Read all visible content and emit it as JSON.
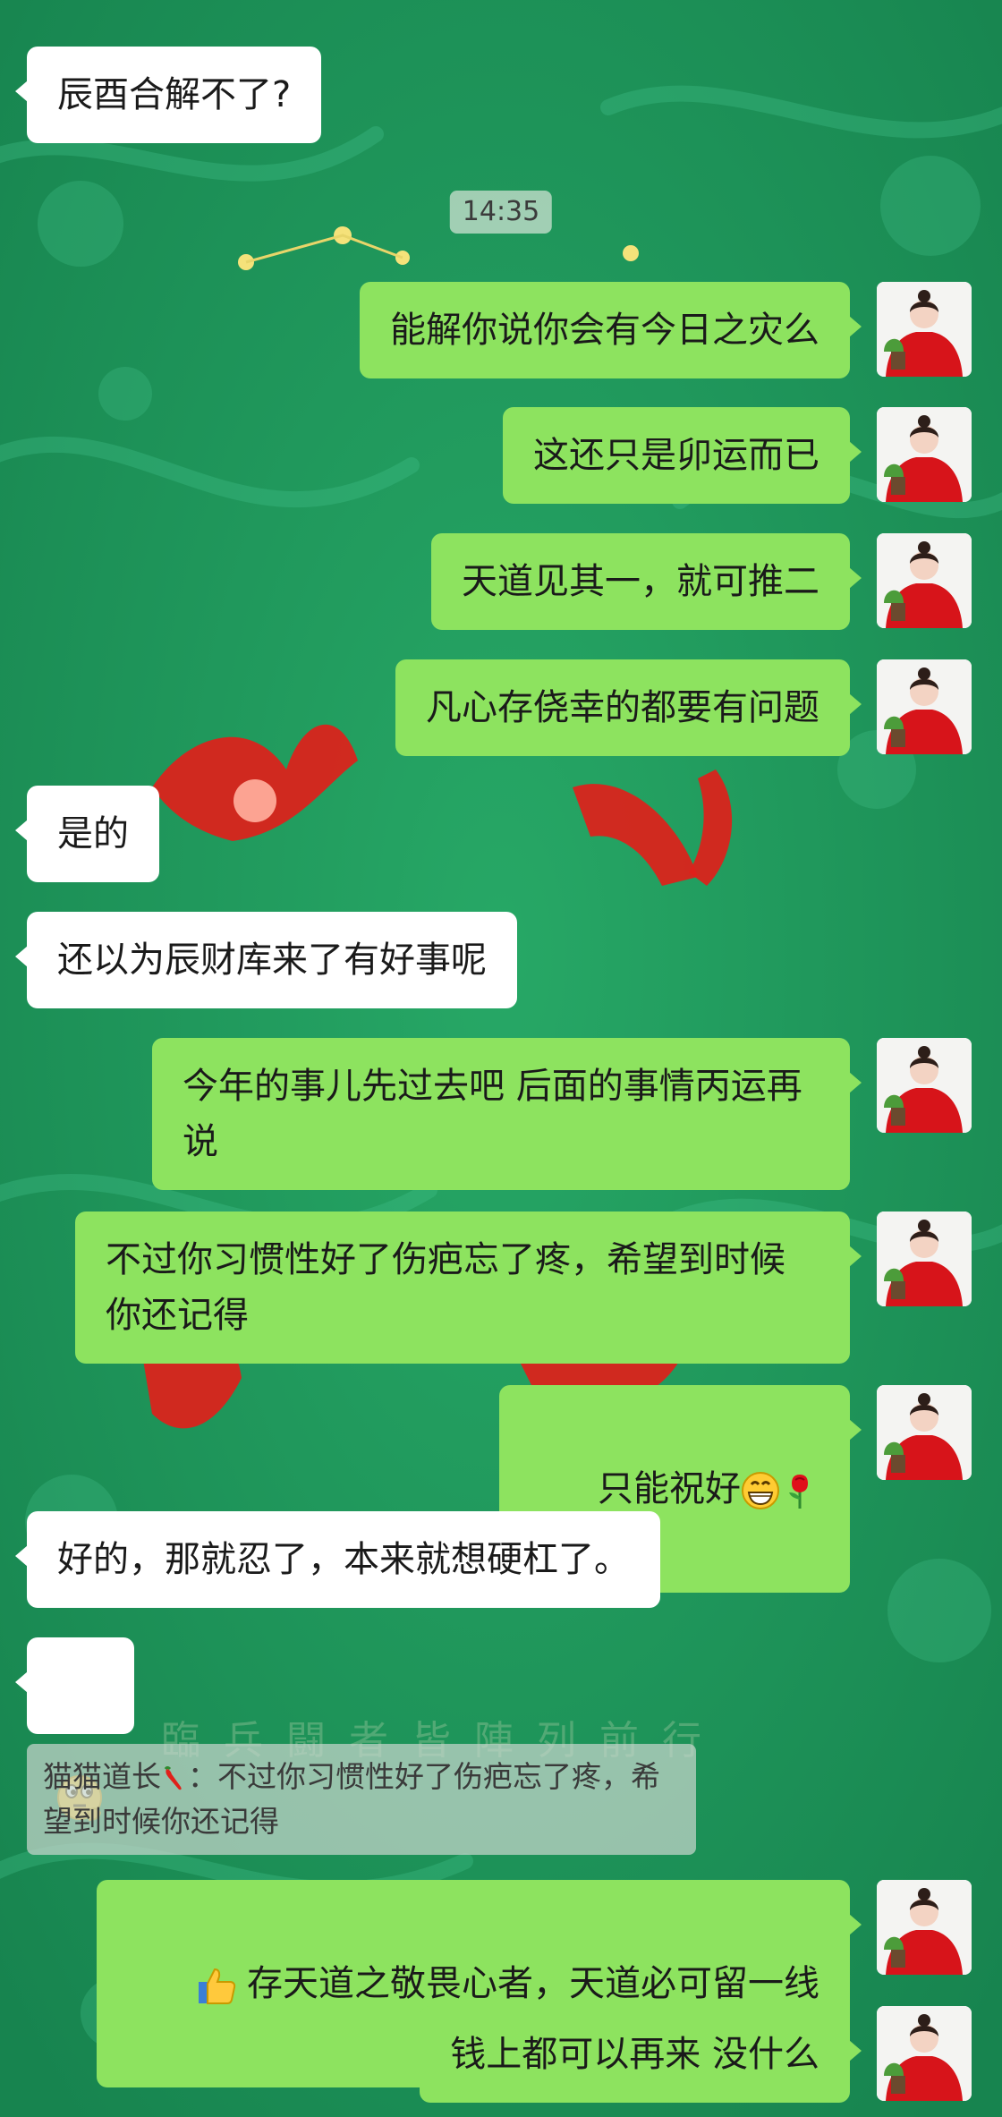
{
  "colors": {
    "background": "#1f9a5e",
    "incoming_bubble": "#ffffff",
    "outgoing_bubble": "#8de35f"
  },
  "timestamp": "14:35",
  "messages": [
    {
      "dir": "in",
      "text": "辰酉合解不了?"
    },
    {
      "dir": "out",
      "text": "能解你说你会有今日之灾么"
    },
    {
      "dir": "out",
      "text": "这还只是卯运而已"
    },
    {
      "dir": "out",
      "text": "天道见其一，就可推二"
    },
    {
      "dir": "out",
      "text": "凡心存侥幸的都要有问题"
    },
    {
      "dir": "in",
      "text": "是的"
    },
    {
      "dir": "in",
      "text": "还以为辰财库来了有好事呢"
    },
    {
      "dir": "out",
      "text": "今年的事儿先过去吧 后面的事情丙运再说"
    },
    {
      "dir": "out",
      "text": "不过你习惯性好了伤疤忘了疼，希望到时候你还记得"
    },
    {
      "dir": "out",
      "text": "只能祝好",
      "emojis": [
        "grin-emoji",
        "rose-emoji"
      ]
    },
    {
      "dir": "in",
      "text": "好的，那就忍了，本来就想硬杠了。"
    },
    {
      "dir": "in",
      "emoji": "thinking-emoji"
    },
    {
      "dir": "out",
      "text": "存天道之敬畏心者，天道必可留一线",
      "lead_emoji": "thumbs-up-emoji"
    },
    {
      "dir": "out",
      "text": "钱上都可以再来 没什么"
    }
  ],
  "quote": {
    "sender": "猫猫道长",
    "sender_emoji": "chili-pepper-emoji",
    "separator": "：",
    "text": "不过你习惯性好了伤疤忘了疼，希望到时候你还记得"
  },
  "background_text": "臨兵闘者皆陣列前行",
  "icons": {
    "avatar": "woman-in-red-dress-avatar"
  }
}
